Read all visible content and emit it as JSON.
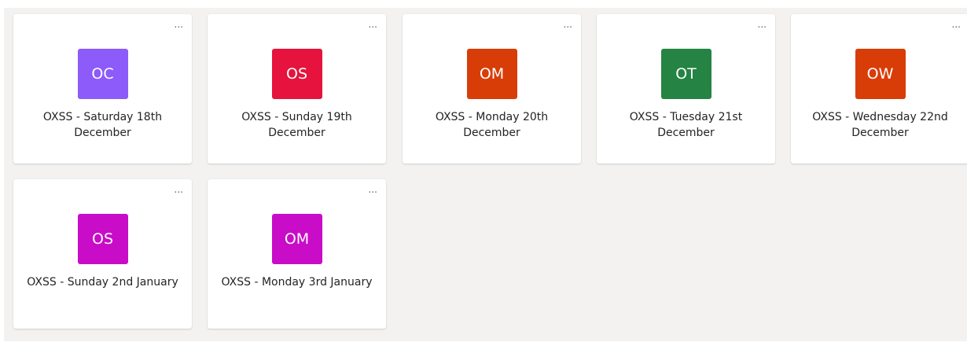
{
  "teams": [
    {
      "initials": "OC",
      "name": "OXSS - Saturday 18th December",
      "color": "#8c5bfa"
    },
    {
      "initials": "OS",
      "name": "OXSS - Sunday 19th December",
      "color": "#e5133d"
    },
    {
      "initials": "OM",
      "name": "OXSS - Monday 20th December",
      "color": "#d83d08"
    },
    {
      "initials": "OT",
      "name": "OXSS - Tuesday 21st December",
      "color": "#258343"
    },
    {
      "initials": "OW",
      "name": "OXSS - Wednesday 22nd December",
      "color": "#d83d08"
    },
    {
      "initials": "OS",
      "name": "OXSS - Sunday 2nd January",
      "color": "#c90cc7"
    },
    {
      "initials": "OM",
      "name": "OXSS - Monday 3rd January",
      "color": "#c90cc7"
    }
  ],
  "more_label": "..."
}
